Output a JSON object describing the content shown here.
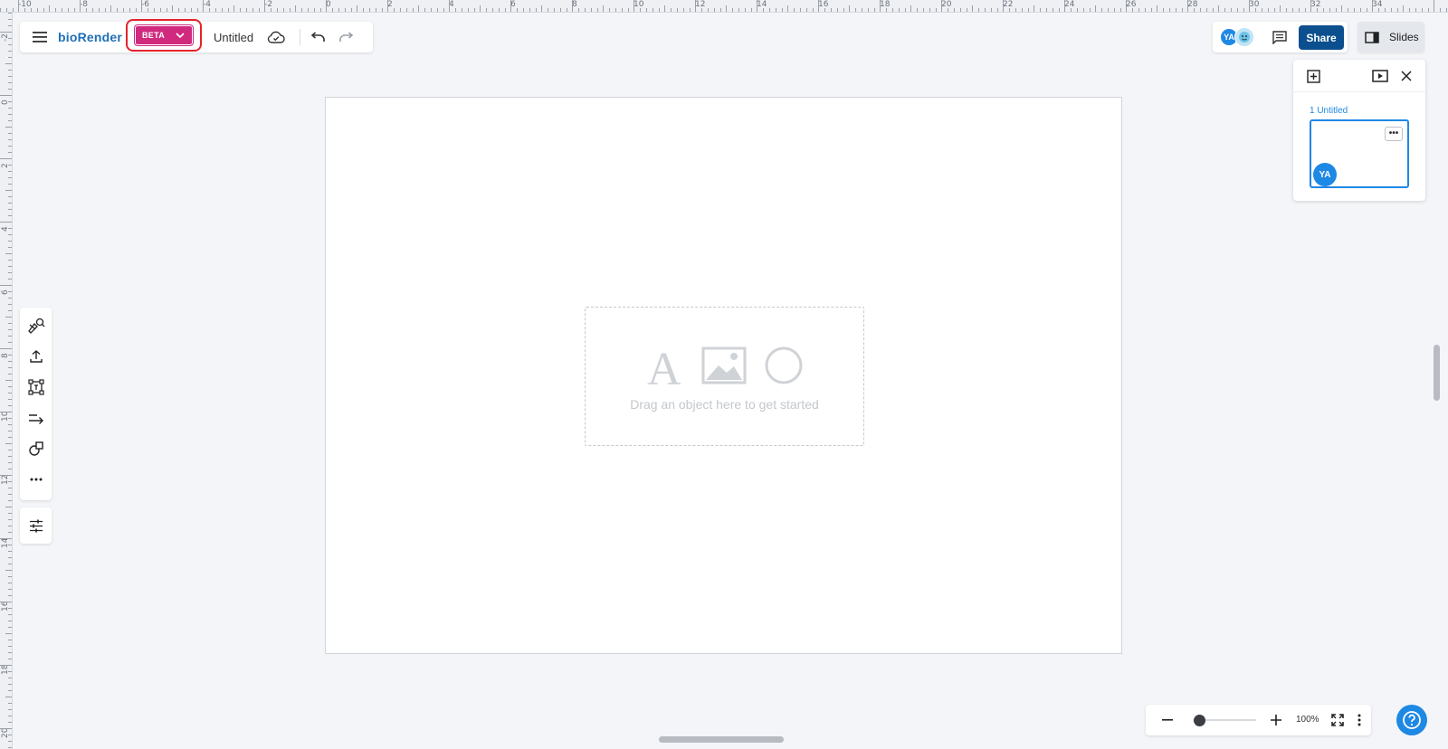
{
  "app": {
    "logo": "bioRender",
    "beta_label": "BETA",
    "document_title": "Untitled"
  },
  "ruler": {
    "top_labels": [
      "-10",
      "-8",
      "-6",
      "-4",
      "-2",
      "0",
      "2",
      "4",
      "6",
      "8",
      "10",
      "12",
      "14",
      "16",
      "18",
      "20",
      "22",
      "24",
      "26",
      "28",
      "30",
      "32",
      "34"
    ],
    "left_labels": [
      "-2",
      "0",
      "2",
      "4",
      "6",
      "8",
      "10",
      "12",
      "14",
      "16",
      "18",
      "20"
    ]
  },
  "header": {
    "collaborator_initials": "YA",
    "share_label": "Share",
    "slides_label": "Slides"
  },
  "slides_panel": {
    "slide_label": "1 Untitled",
    "more_label": "•••",
    "slide_avatar": "YA"
  },
  "canvas": {
    "dropzone_text": "Drag an object here to get started"
  },
  "zoom": {
    "value": "100%",
    "level_fraction": 0.1
  },
  "icons": {
    "menu": "hamburger-icon",
    "cloud": "cloud-saved-icon",
    "undo": "undo-icon",
    "redo": "redo-icon",
    "comment": "comment-icon",
    "slides": "slides-panel-icon",
    "add_slide": "add-slide-icon",
    "present": "present-icon",
    "close": "close-icon",
    "help": "help-icon"
  },
  "colors": {
    "brand": "#1e6fb7",
    "beta": "#d02a7f",
    "share": "#0b4f8e",
    "accent": "#1e88e5",
    "highlight": "#e5222b"
  }
}
